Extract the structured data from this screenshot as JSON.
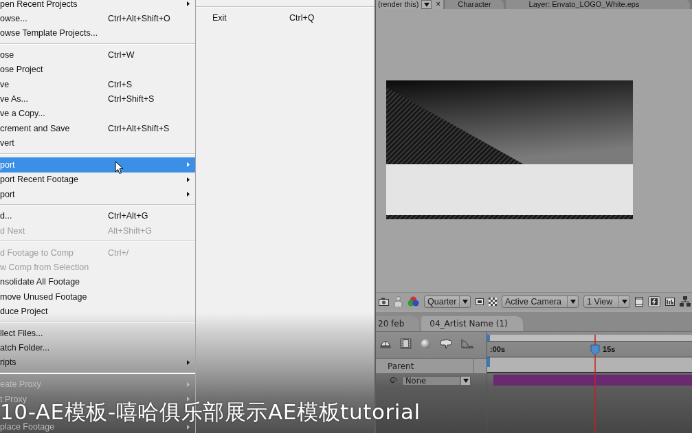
{
  "file_menu": {
    "groups": [
      {
        "items": [
          {
            "label": "pen Recent Projects",
            "submenu": true,
            "disabled": false,
            "selected": false
          },
          {
            "label": "owse...",
            "shortcut": "Ctrl+Alt+Shift+O",
            "submenu": false,
            "disabled": false,
            "selected": false
          },
          {
            "label": "owse Template Projects...",
            "submenu": false,
            "disabled": false,
            "selected": false
          }
        ]
      },
      {
        "items": [
          {
            "label": "ose",
            "shortcut": "Ctrl+W",
            "submenu": false,
            "disabled": false,
            "selected": false
          },
          {
            "label": "ose Project",
            "submenu": false,
            "disabled": false,
            "selected": false
          },
          {
            "label": "ve",
            "shortcut": "Ctrl+S",
            "submenu": false,
            "disabled": false,
            "selected": false
          },
          {
            "label": "ve As...",
            "shortcut": "Ctrl+Shift+S",
            "submenu": false,
            "disabled": false,
            "selected": false
          },
          {
            "label": "ve a Copy...",
            "submenu": false,
            "disabled": false,
            "selected": false
          },
          {
            "label": "crement and Save",
            "shortcut": "Ctrl+Alt+Shift+S",
            "submenu": false,
            "disabled": false,
            "selected": false
          },
          {
            "label": "vert",
            "submenu": false,
            "disabled": false,
            "selected": false
          }
        ]
      },
      {
        "items": [
          {
            "label": "port",
            "submenu": true,
            "disabled": false,
            "selected": true
          },
          {
            "label": "port Recent Footage",
            "submenu": true,
            "disabled": false,
            "selected": false
          },
          {
            "label": "port",
            "submenu": true,
            "disabled": false,
            "selected": false
          }
        ]
      },
      {
        "items": [
          {
            "label": "d...",
            "shortcut": "Ctrl+Alt+G",
            "submenu": false,
            "disabled": false,
            "selected": false
          },
          {
            "label": "d Next",
            "shortcut": "Alt+Shift+G",
            "submenu": false,
            "disabled": true,
            "selected": false
          }
        ]
      },
      {
        "items": [
          {
            "label": "d Footage to Comp",
            "shortcut": "Ctrl+/",
            "submenu": false,
            "disabled": true,
            "selected": false
          },
          {
            "label": "w Comp from Selection",
            "submenu": false,
            "disabled": true,
            "selected": false
          },
          {
            "label": "nsolidate All Footage",
            "submenu": false,
            "disabled": false,
            "selected": false
          },
          {
            "label": "move Unused Footage",
            "submenu": false,
            "disabled": false,
            "selected": false
          },
          {
            "label": "duce Project",
            "submenu": false,
            "disabled": false,
            "selected": false
          }
        ]
      },
      {
        "items": [
          {
            "label": "llect Files...",
            "submenu": false,
            "disabled": false,
            "selected": false
          },
          {
            "label": "atch Folder...",
            "submenu": false,
            "disabled": false,
            "selected": false
          },
          {
            "label": "ripts",
            "submenu": true,
            "disabled": false,
            "selected": false
          }
        ]
      },
      {
        "items": [
          {
            "label": "eate Proxy",
            "submenu": true,
            "disabled": true,
            "selected": false
          },
          {
            "label": "t Proxy",
            "submenu": true,
            "disabled": true,
            "selected": false
          },
          {
            "label": "place Footage",
            "submenu": true,
            "disabled": true,
            "selected": false
          }
        ]
      }
    ]
  },
  "file_menu_column_2": {
    "groups": [
      {
        "items": [
          {
            "label": "Exit",
            "shortcut": "Ctrl+Q",
            "submenu": false,
            "disabled": false,
            "selected": false
          }
        ]
      }
    ]
  },
  "viewer": {
    "tabs": [
      {
        "label": "(render this)",
        "selected": true,
        "close": "×"
      },
      {
        "label": "Character",
        "selected": false
      },
      {
        "label": "Layer: Envato_LOGO_White.eps",
        "selected": false
      }
    ],
    "dropdowns": [
      {
        "value": "Quarter"
      },
      {
        "value": "Active Camera"
      },
      {
        "value": "1 View"
      }
    ]
  },
  "timeline": {
    "tabs": [
      {
        "label": "20 feb",
        "selected": false
      },
      {
        "label": "04_Artist Name (1)",
        "selected": true
      }
    ],
    "ruler": [
      ":00s",
      "15s"
    ],
    "columns": [
      "Parent"
    ],
    "layers": [
      {
        "parent": "None",
        "color": "#6a2a70"
      }
    ]
  },
  "caption": "10-AE模板-嘻哈俱乐部展示AE模板tutorial"
}
